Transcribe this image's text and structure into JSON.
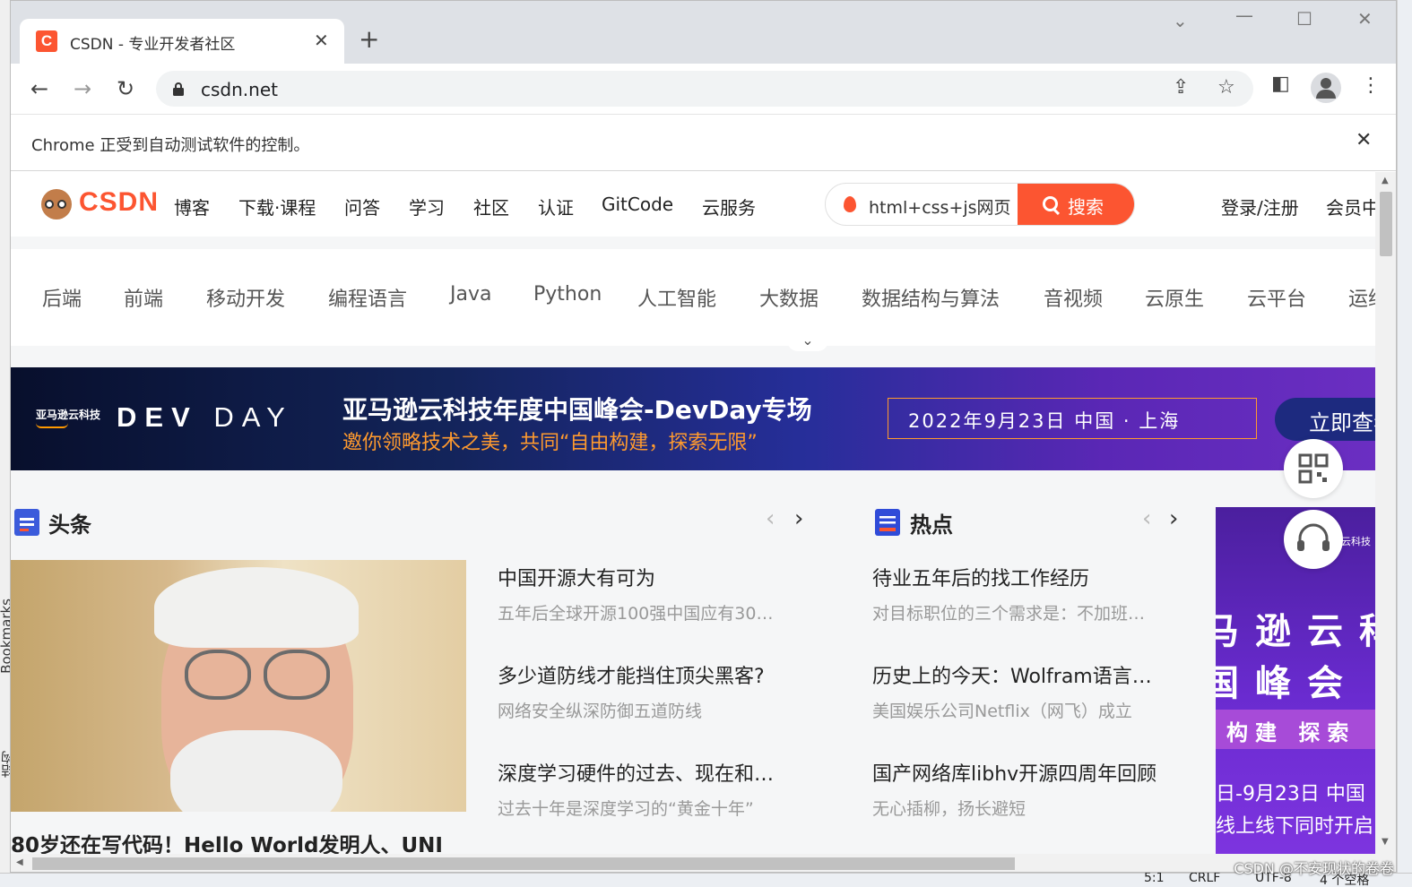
{
  "ide": {
    "left_label_1": "Bookmarks",
    "left_label_2": "结构",
    "status_position": "5:1",
    "status_line_ending": "CRLF",
    "status_encoding": "UTF-8",
    "status_indent": "4 个空格",
    "watermark": "CSDN @不安现状的卷卷"
  },
  "browser": {
    "tab_title": "CSDN - 专业开发者社区",
    "favicon_letter": "C",
    "url": "csdn.net",
    "infobar_text": "Chrome 正受到自动测试软件的控制。"
  },
  "site": {
    "logo_text": "CSDN",
    "nav": [
      "博客",
      "下载·课程",
      "问答",
      "学习",
      "社区",
      "认证",
      "GitCode",
      "云服务"
    ],
    "search_value": "html+css+js网页",
    "search_button": "搜索",
    "login": "登录/注册",
    "member": "会员中心"
  },
  "categories": [
    "后端",
    "前端",
    "移动开发",
    "编程语言",
    "Java",
    "Python",
    "人工智能",
    "大数据",
    "数据结构与算法",
    "音视频",
    "云原生",
    "云平台",
    "运维"
  ],
  "banner": {
    "brand": "亚马逊云科技",
    "dev": "DEV",
    "day": "DAY",
    "title": "亚马逊云科技年度中国峰会-DevDay专场",
    "subtitle": "邀你领略技术之美，共同“自由构建，探索无限”",
    "date": "2022年9月23日  中国 · 上海",
    "cta": "立即查看"
  },
  "headlines": {
    "title": "头条",
    "photo_caption": "80岁还在写代码！Hello World发明人、UNI",
    "items": [
      {
        "title": "中国开源大有可为",
        "sub": "五年后全球开源100强中国应有30…"
      },
      {
        "title": "多少道防线才能挡住顶尖黑客?",
        "sub": "网络安全纵深防御五道防线"
      },
      {
        "title": "深度学习硬件的过去、现在和…",
        "sub": "过去十年是深度学习的“黄金十年”"
      }
    ]
  },
  "hot": {
    "title": "热点",
    "items": [
      {
        "title": "待业五年后的找工作经历",
        "sub": "对目标职位的三个需求是：不加班…"
      },
      {
        "title": "历史上的今天：Wolfram语言…",
        "sub": "美国娱乐公司Netflix（网飞）成立"
      },
      {
        "title": "国产网络库libhv开源四周年回顾",
        "sub": "无心插柳，扬长避短"
      }
    ]
  },
  "side_ad": {
    "tiny": "云科技",
    "row1": "马逊云科",
    "row2": "国峰会",
    "strip": "构建 探索",
    "line1": "日-9月23日 中国",
    "line2": "线上线下同时开启"
  },
  "colors": {
    "brand": "#fc5531",
    "banner_accent": "#ff9a2e",
    "headline_icon": "#3b5bdb",
    "hot_icon": "#2f4bd8"
  },
  "icons": [
    "back-icon",
    "forward-icon",
    "reload-icon",
    "lock-icon",
    "share-icon",
    "star-icon",
    "sidepanel-icon",
    "profile-icon",
    "menu-icon",
    "flame-icon",
    "search-icon",
    "qrcode-icon",
    "headset-icon"
  ]
}
